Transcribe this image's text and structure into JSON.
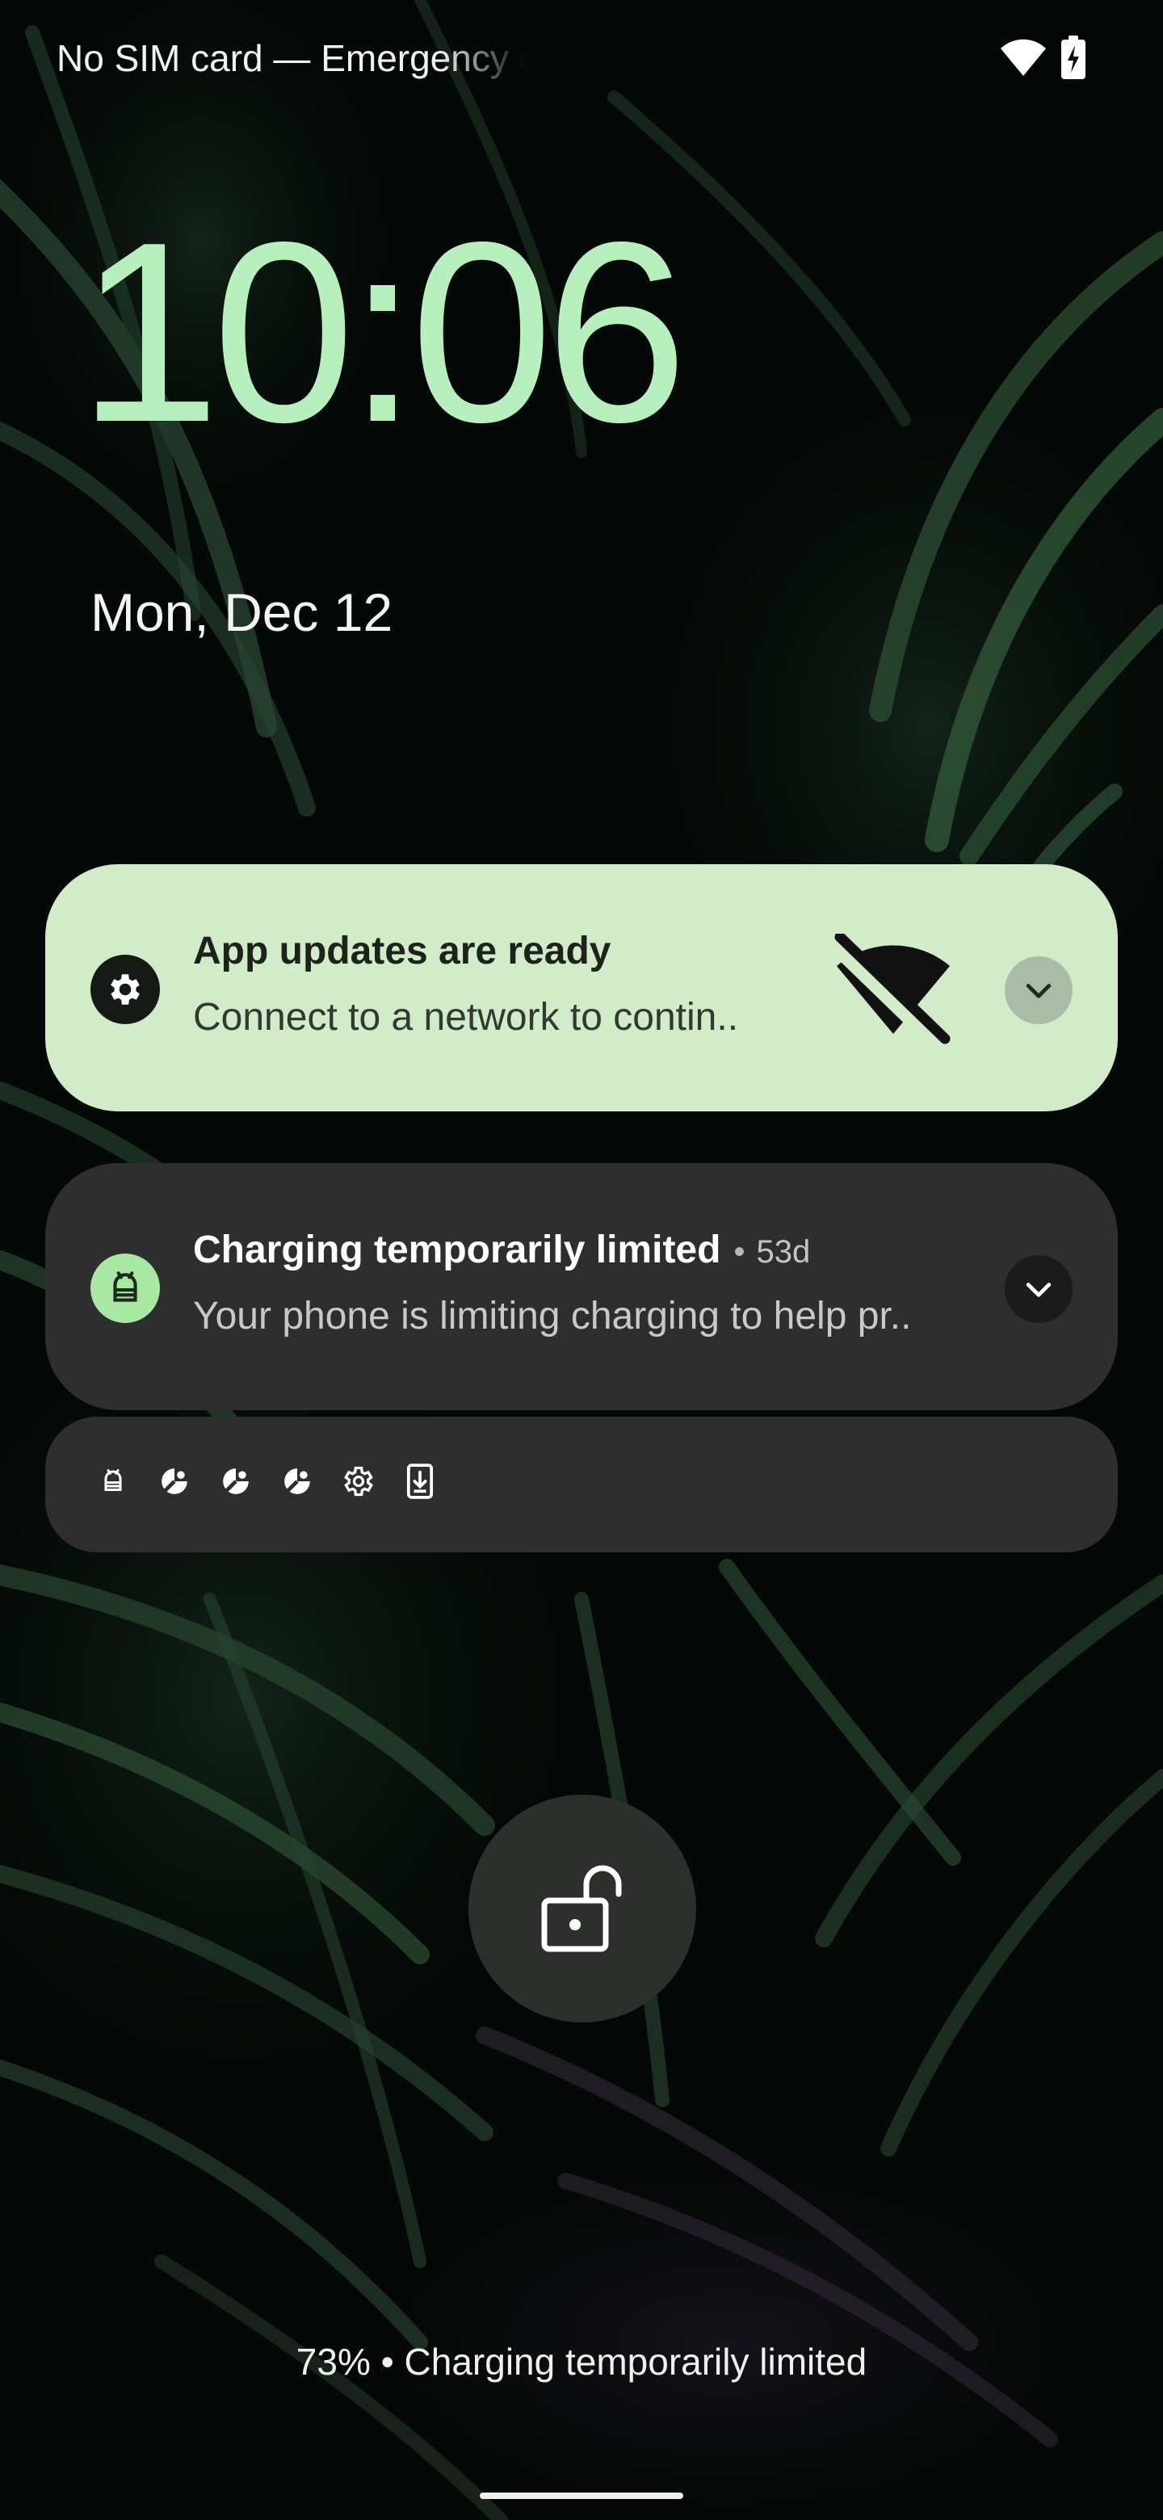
{
  "status_bar": {
    "carrier_text": "No SIM card — Emergency calls only",
    "wifi_icon": "wifi-icon",
    "battery_icon": "battery-charging-icon"
  },
  "clock": {
    "time": "10:06",
    "color": "#b7efbe"
  },
  "date": "Mon, Dec 12",
  "notifications": [
    {
      "app_icon": "gear-icon",
      "title": "App updates are ready",
      "body": "Connect to a network to contin..",
      "large_icon": "wifi-off-icon",
      "expand_icon": "chevron-down-icon",
      "background": "#d2ecca"
    },
    {
      "app_icon": "android-icon",
      "title": "Charging temporarily limited",
      "separator": "•",
      "time_ago": "53d",
      "body": "Your phone is limiting charging to help pr..",
      "expand_icon": "chevron-down-icon",
      "background": "#2e2e2e"
    }
  ],
  "overflow_icons": [
    "android-icon",
    "leaf-icon",
    "leaf-icon",
    "leaf-icon",
    "gear-icon",
    "phone-download-icon"
  ],
  "lock_icon": "unlocked-padlock-icon",
  "charging_indication": "73% • Charging temporarily limited",
  "nav_handle": "gesture-handle"
}
